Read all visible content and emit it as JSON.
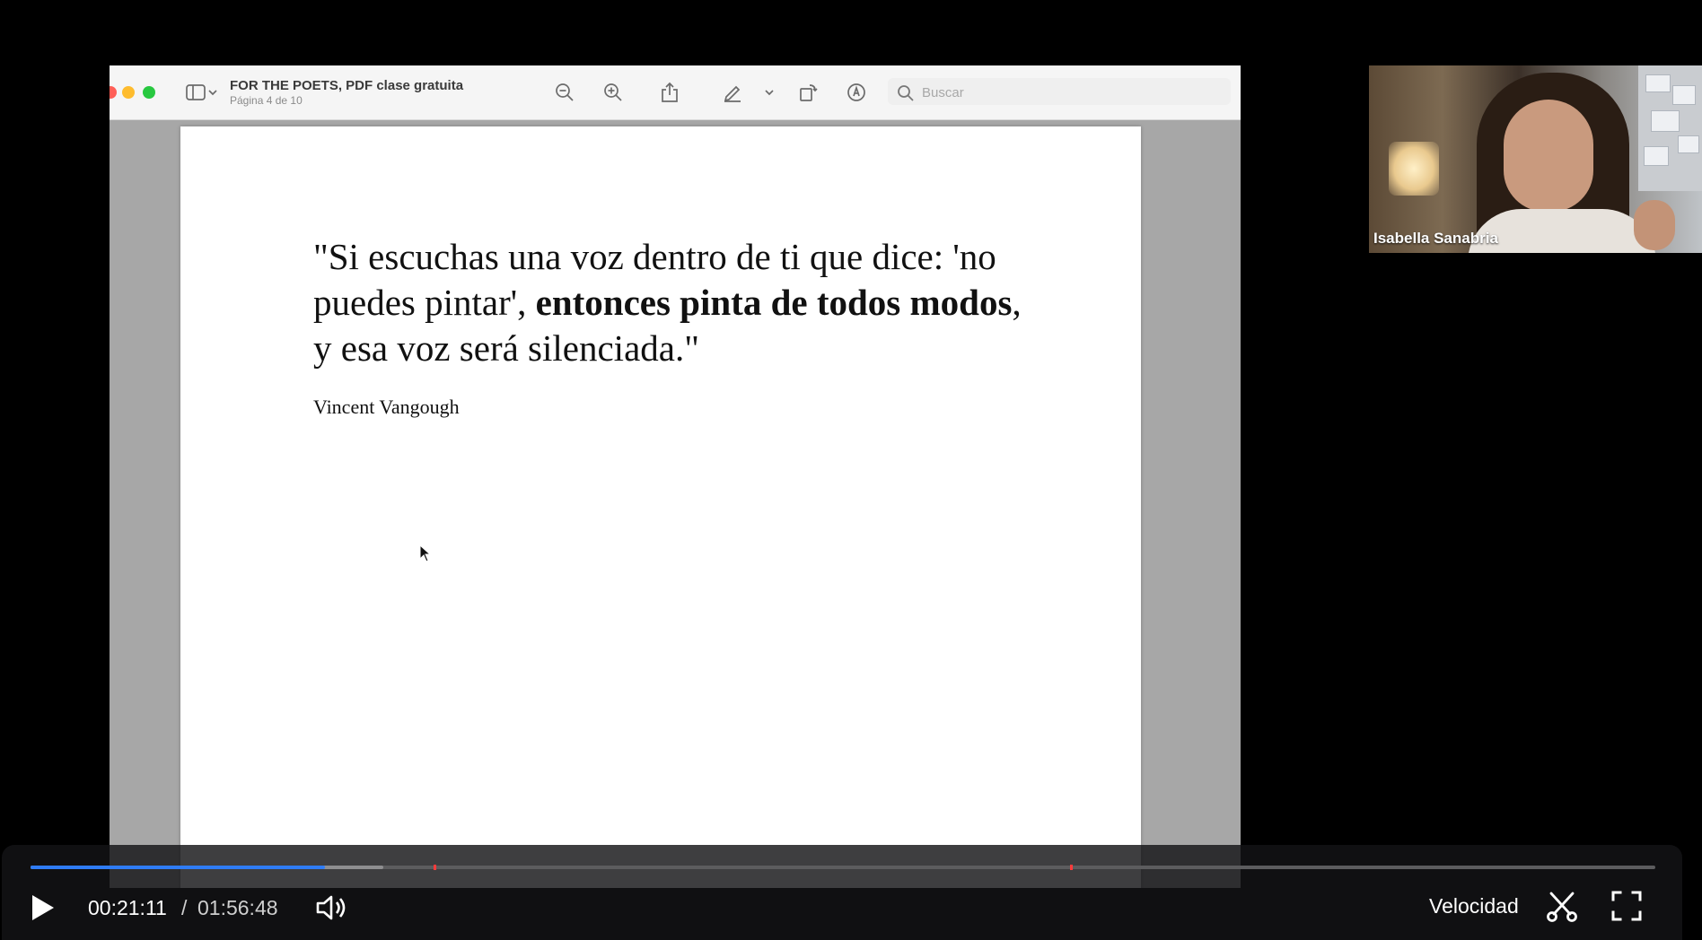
{
  "pdf_viewer": {
    "title": "FOR THE POETS, PDF clase gratuita",
    "subtitle": "Página 4 de 10",
    "search_placeholder": "Buscar",
    "page_content": {
      "quote_part1": "\"Si escuchas una voz dentro de ti que dice: 'no puedes pintar', ",
      "quote_bold": "entonces pinta de todos modos",
      "quote_part2": ", y esa voz será silenciada.\"",
      "author": "Vincent Vangough"
    }
  },
  "participant": {
    "name": "Isabella Sanabria"
  },
  "player": {
    "current_time": "00:21:11",
    "separator": "/",
    "total_time": "01:56:48",
    "progress_fraction": 0.181,
    "buffered_fraction": 0.217,
    "marker_fractions": [
      0.248,
      0.64
    ],
    "speed_label": "Velocidad",
    "accent_color": "#2f7cf6"
  },
  "icons": [
    "sidebar-toggle-icon",
    "chevron-down-icon",
    "zoom-out-icon",
    "zoom-in-icon",
    "share-icon",
    "highlight-pen-icon",
    "rotate-icon",
    "markup-icon",
    "search-icon",
    "mouse-cursor-icon",
    "play-icon",
    "volume-icon",
    "scissors-icon",
    "fullscreen-icon"
  ]
}
